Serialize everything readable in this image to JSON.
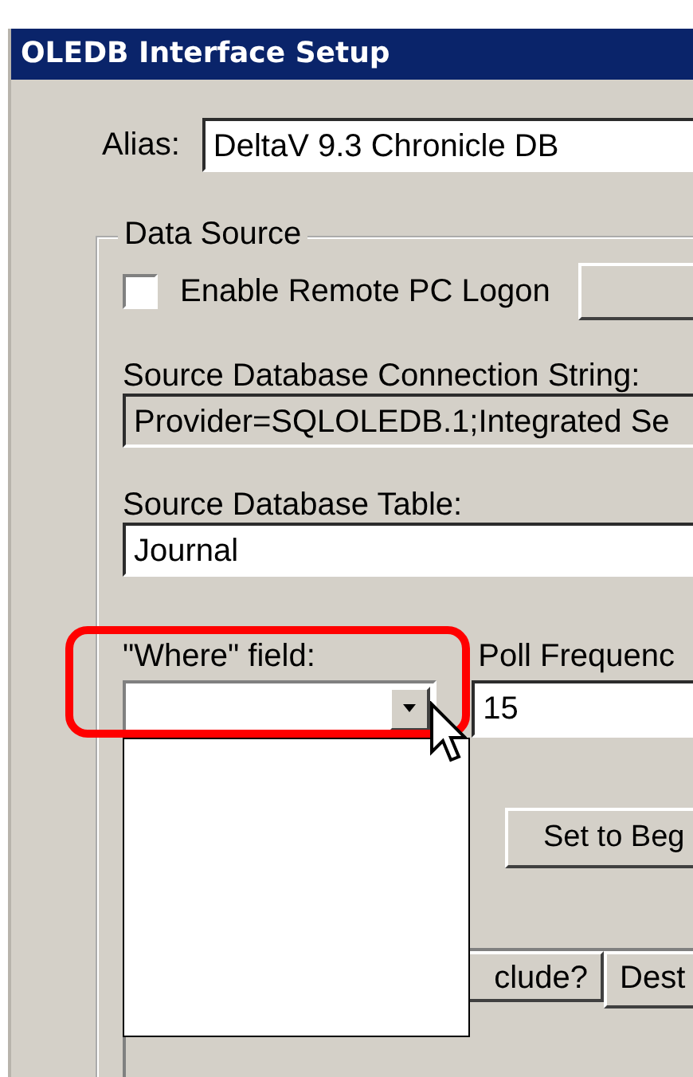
{
  "window": {
    "title": "OLEDB Interface Setup"
  },
  "alias": {
    "label": "Alias:",
    "value": "DeltaV 9.3 Chronicle DB"
  },
  "data_source": {
    "title": "Data Source",
    "remote_logon": {
      "label": "Enable Remote PC Logon",
      "checked": false
    },
    "connection_string": {
      "label": "Source Database Connection String:",
      "value": "Provider=SQLOLEDB.1;Integrated Se",
      "disabled": true
    },
    "table": {
      "label": "Source Database Table:",
      "value": "Journal"
    },
    "where_field": {
      "label": "\"Where\" field:",
      "expanded": true
    },
    "poll_frequency": {
      "label": "Poll Frequenc",
      "value": "15"
    },
    "set_button": "Set to Beg",
    "grid_columns": [
      "clude?",
      "Dest"
    ]
  }
}
